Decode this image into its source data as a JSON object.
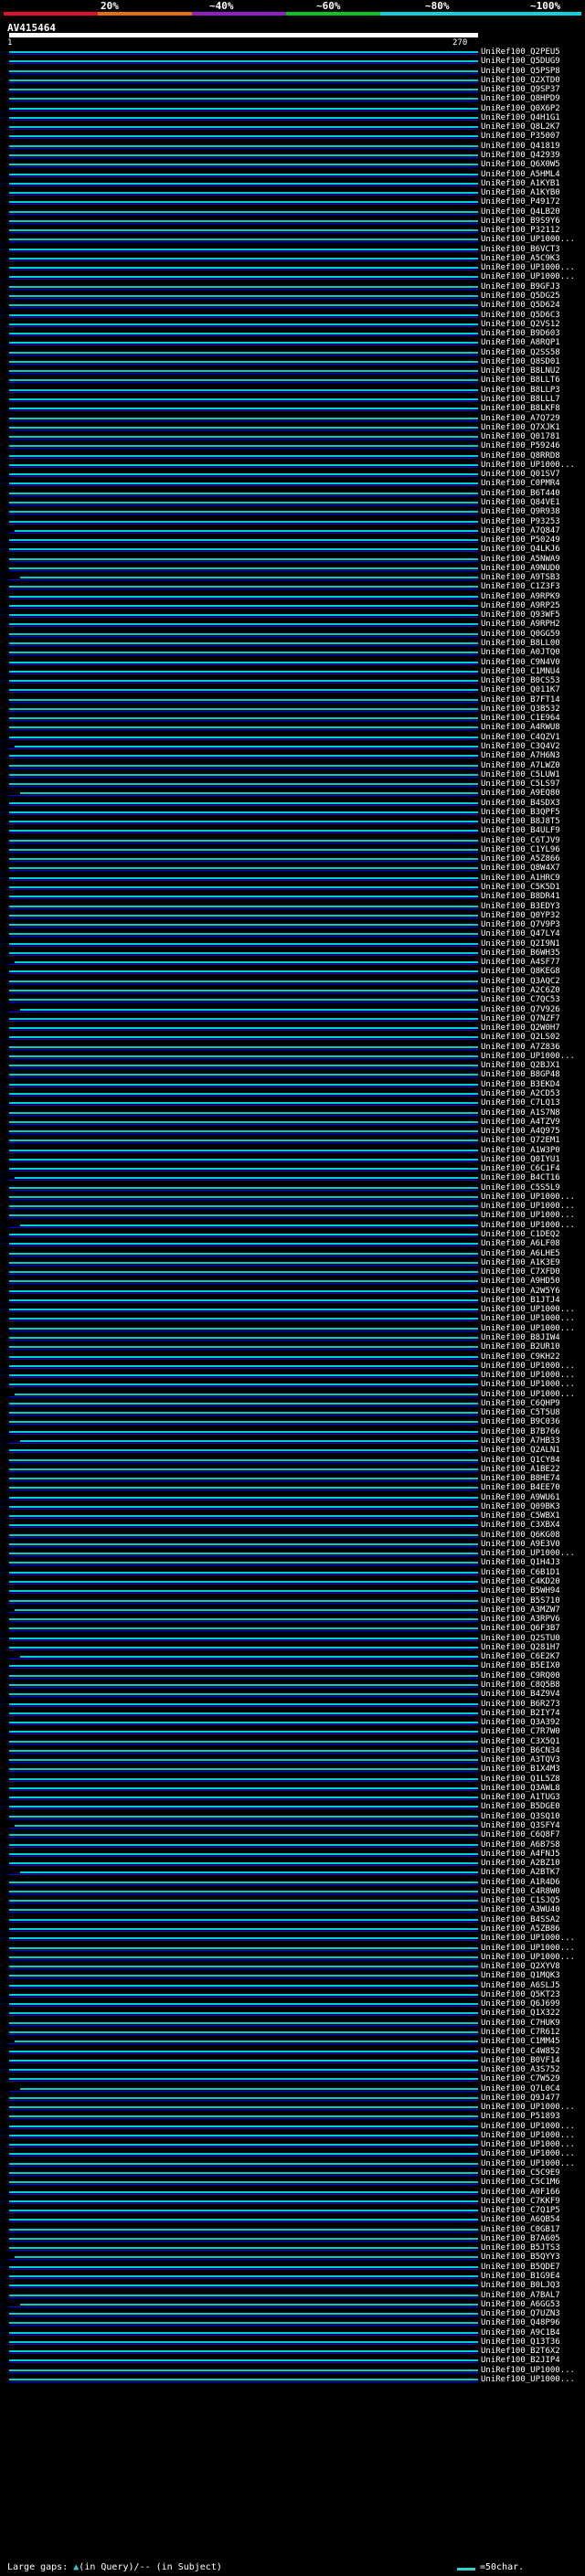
{
  "scale": {
    "ticks": [
      "20%",
      "~40%",
      "~60%",
      "~80%",
      "~100%"
    ],
    "colors": [
      "#e0102a",
      "#e07010",
      "#9020c0",
      "#10c020",
      "#10d0e0"
    ]
  },
  "query": {
    "id": "AV415464",
    "start": "1",
    "end": "270"
  },
  "line_color": "#00cccc",
  "hits": [
    {
      "id": "UniRef100_Q2PEU5"
    },
    {
      "id": "UniRef100_Q5DUG9"
    },
    {
      "id": "UniRef100_Q5PSP8"
    },
    {
      "id": "UniRef100_Q2XTD0"
    },
    {
      "id": "UniRef100_Q9SP37"
    },
    {
      "id": "UniRef100_Q8HPD9"
    },
    {
      "id": "UniRef100_Q0X6P2"
    },
    {
      "id": "UniRef100_Q4H1G1"
    },
    {
      "id": "UniRef100_Q8L2K7"
    },
    {
      "id": "UniRef100_P35007"
    },
    {
      "id": "UniRef100_Q41819"
    },
    {
      "id": "UniRef100_Q42939"
    },
    {
      "id": "UniRef100_Q6X0W5"
    },
    {
      "id": "UniRef100_A5HML4"
    },
    {
      "id": "UniRef100_A1KYB1"
    },
    {
      "id": "UniRef100_A1KYB0"
    },
    {
      "id": "UniRef100_P49172"
    },
    {
      "id": "UniRef100_Q4LB20"
    },
    {
      "id": "UniRef100_B9S9Y6"
    },
    {
      "id": "UniRef100_P32112"
    },
    {
      "id": "UniRef100_UP1000..."
    },
    {
      "id": "UniRef100_B6VCT3"
    },
    {
      "id": "UniRef100_A5C9K3"
    },
    {
      "id": "UniRef100_UP1000..."
    },
    {
      "id": "UniRef100_UP1000..."
    },
    {
      "id": "UniRef100_B9GFJ3"
    },
    {
      "id": "UniRef100_Q5DG25"
    },
    {
      "id": "UniRef100_Q5D624"
    },
    {
      "id": "UniRef100_Q5D6C3"
    },
    {
      "id": "UniRef100_Q2VS12"
    },
    {
      "id": "UniRef100_B9D603"
    },
    {
      "id": "UniRef100_A8RQP1"
    },
    {
      "id": "UniRef100_Q2SS58"
    },
    {
      "id": "UniRef100_Q8SD01"
    },
    {
      "id": "UniRef100_B8LNU2"
    },
    {
      "id": "UniRef100_B8LLT6"
    },
    {
      "id": "UniRef100_B8LLP3"
    },
    {
      "id": "UniRef100_B8LLL7"
    },
    {
      "id": "UniRef100_B8LKF8"
    },
    {
      "id": "UniRef100_A7Q729"
    },
    {
      "id": "UniRef100_Q7XJK1"
    },
    {
      "id": "UniRef100_Q01781"
    },
    {
      "id": "UniRef100_P59246"
    },
    {
      "id": "UniRef100_Q8RRD8"
    },
    {
      "id": "UniRef100_UP1000..."
    },
    {
      "id": "UniRef100_Q01SV7"
    },
    {
      "id": "UniRef100_C0PMR4"
    },
    {
      "id": "UniRef100_B6T440"
    },
    {
      "id": "UniRef100_Q84VE1"
    },
    {
      "id": "UniRef100_Q9R938"
    },
    {
      "id": "UniRef100_P93253"
    },
    {
      "id": "UniRef100_A7Q847"
    },
    {
      "id": "UniRef100_P50249"
    },
    {
      "id": "UniRef100_Q4LKJ6"
    },
    {
      "id": "UniRef100_A5NWA9"
    },
    {
      "id": "UniRef100_A9NUD0"
    },
    {
      "id": "UniRef100_A9TSB3"
    },
    {
      "id": "UniRef100_C1Z3F3"
    },
    {
      "id": "UniRef100_A9RPK9"
    },
    {
      "id": "UniRef100_A9RP25"
    },
    {
      "id": "UniRef100_Q93WF5"
    },
    {
      "id": "UniRef100_A9RPH2"
    },
    {
      "id": "UniRef100_Q0GG59"
    },
    {
      "id": "UniRef100_B8LL00"
    },
    {
      "id": "UniRef100_A0JTQ0"
    },
    {
      "id": "UniRef100_C9N4V0"
    },
    {
      "id": "UniRef100_C1MNU4"
    },
    {
      "id": "UniRef100_B0CS53"
    },
    {
      "id": "UniRef100_Q011K7"
    },
    {
      "id": "UniRef100_B7FT14"
    },
    {
      "id": "UniRef100_Q3B532"
    },
    {
      "id": "UniRef100_C1E964"
    },
    {
      "id": "UniRef100_A4RWU8"
    },
    {
      "id": "UniRef100_C4QZV1"
    },
    {
      "id": "UniRef100_C3Q4V2"
    },
    {
      "id": "UniRef100_A7H6N3"
    },
    {
      "id": "UniRef100_A7LWZ0"
    },
    {
      "id": "UniRef100_C5LUW1"
    },
    {
      "id": "UniRef100_C5LS97"
    },
    {
      "id": "UniRef100_A9EQ80"
    },
    {
      "id": "UniRef100_B4SDX3"
    },
    {
      "id": "UniRef100_B3QPF5"
    },
    {
      "id": "UniRef100_B8J8T5"
    },
    {
      "id": "UniRef100_B4ULF9"
    },
    {
      "id": "UniRef100_C6TJV9"
    },
    {
      "id": "UniRef100_C1YL96"
    },
    {
      "id": "UniRef100_A5Z866"
    },
    {
      "id": "UniRef100_Q8W4X7"
    },
    {
      "id": "UniRef100_A1HRC9"
    },
    {
      "id": "UniRef100_C5K5D1"
    },
    {
      "id": "UniRef100_B8DR41"
    },
    {
      "id": "UniRef100_B3EDY3"
    },
    {
      "id": "UniRef100_Q0YP32"
    },
    {
      "id": "UniRef100_Q7V9P3"
    },
    {
      "id": "UniRef100_Q47LY4"
    },
    {
      "id": "UniRef100_Q2I9N1"
    },
    {
      "id": "UniRef100_B6WH35"
    },
    {
      "id": "UniRef100_A4SF77"
    },
    {
      "id": "UniRef100_Q8KEG8"
    },
    {
      "id": "UniRef100_Q3AQC2"
    },
    {
      "id": "UniRef100_A2C6Z0"
    },
    {
      "id": "UniRef100_C7QC53"
    },
    {
      "id": "UniRef100_Q7V926"
    },
    {
      "id": "UniRef100_Q7NZF7"
    },
    {
      "id": "UniRef100_Q2W0H7"
    },
    {
      "id": "UniRef100_Q2LS02"
    },
    {
      "id": "UniRef100_A7Z836"
    },
    {
      "id": "UniRef100_UP1000..."
    },
    {
      "id": "UniRef100_Q2BJX1"
    },
    {
      "id": "UniRef100_B8GP48"
    },
    {
      "id": "UniRef100_B3EKD4"
    },
    {
      "id": "UniRef100_A2CD53"
    },
    {
      "id": "UniRef100_C7LQ13"
    },
    {
      "id": "UniRef100_A1S7N8"
    },
    {
      "id": "UniRef100_A4TZV9"
    },
    {
      "id": "UniRef100_A4Q975"
    },
    {
      "id": "UniRef100_Q72EM1"
    },
    {
      "id": "UniRef100_A1W3P0"
    },
    {
      "id": "UniRef100_Q0IYU1"
    },
    {
      "id": "UniRef100_C6C1F4"
    },
    {
      "id": "UniRef100_B4CT16"
    },
    {
      "id": "UniRef100_C5S5L9"
    },
    {
      "id": "UniRef100_UP1000..."
    },
    {
      "id": "UniRef100_UP1000..."
    },
    {
      "id": "UniRef100_UP1000..."
    },
    {
      "id": "UniRef100_UP1000..."
    },
    {
      "id": "UniRef100_C1DEQ2"
    },
    {
      "id": "UniRef100_A6LF08"
    },
    {
      "id": "UniRef100_A6LHE5"
    },
    {
      "id": "UniRef100_A1K3E9"
    },
    {
      "id": "UniRef100_C7XFD0"
    },
    {
      "id": "UniRef100_A9HD50"
    },
    {
      "id": "UniRef100_A2W5Y6"
    },
    {
      "id": "UniRef100_B1JTJ4"
    },
    {
      "id": "UniRef100_UP1000..."
    },
    {
      "id": "UniRef100_UP1000..."
    },
    {
      "id": "UniRef100_UP1000..."
    },
    {
      "id": "UniRef100_B8JIW4"
    },
    {
      "id": "UniRef100_B2UR10"
    },
    {
      "id": "UniRef100_C9KH22"
    },
    {
      "id": "UniRef100_UP1000..."
    },
    {
      "id": "UniRef100_UP1000..."
    },
    {
      "id": "UniRef100_UP1000..."
    },
    {
      "id": "UniRef100_UP1000..."
    },
    {
      "id": "UniRef100_C6QHP9"
    },
    {
      "id": "UniRef100_C5T5U8"
    },
    {
      "id": "UniRef100_B9C036"
    },
    {
      "id": "UniRef100_B7B766"
    },
    {
      "id": "UniRef100_A7HB33"
    },
    {
      "id": "UniRef100_Q2ALN1"
    },
    {
      "id": "UniRef100_Q1CY84"
    },
    {
      "id": "UniRef100_A1BE22"
    },
    {
      "id": "UniRef100_B8HE74"
    },
    {
      "id": "UniRef100_B4EE70"
    },
    {
      "id": "UniRef100_A9WU61"
    },
    {
      "id": "UniRef100_Q09BK3"
    },
    {
      "id": "UniRef100_C5WBX1"
    },
    {
      "id": "UniRef100_C3XBX4"
    },
    {
      "id": "UniRef100_Q6KG08"
    },
    {
      "id": "UniRef100_A9E3V0"
    },
    {
      "id": "UniRef100_UP1000..."
    },
    {
      "id": "UniRef100_Q1H4J3"
    },
    {
      "id": "UniRef100_C6B1D1"
    },
    {
      "id": "UniRef100_C4KD20"
    },
    {
      "id": "UniRef100_B5WH94"
    },
    {
      "id": "UniRef100_B5S710"
    },
    {
      "id": "UniRef100_A3MZW7"
    },
    {
      "id": "UniRef100_A3RPV6"
    },
    {
      "id": "UniRef100_Q6F3B7"
    },
    {
      "id": "UniRef100_Q2STU0"
    },
    {
      "id": "UniRef100_Q281H7"
    },
    {
      "id": "UniRef100_C6E2K7"
    },
    {
      "id": "UniRef100_B5EIX0"
    },
    {
      "id": "UniRef100_C9RQ00"
    },
    {
      "id": "UniRef100_C8Q5B8"
    },
    {
      "id": "UniRef100_B4Z9V4"
    },
    {
      "id": "UniRef100_B6R273"
    },
    {
      "id": "UniRef100_B2IY74"
    },
    {
      "id": "UniRef100_Q3A392"
    },
    {
      "id": "UniRef100_C7R7W0"
    },
    {
      "id": "UniRef100_C3X5Q1"
    },
    {
      "id": "UniRef100_B6CN34"
    },
    {
      "id": "UniRef100_A3TQV3"
    },
    {
      "id": "UniRef100_B1X4M3"
    },
    {
      "id": "UniRef100_Q1L5Z8"
    },
    {
      "id": "UniRef100_Q3AWL8"
    },
    {
      "id": "UniRef100_A1TUG3"
    },
    {
      "id": "UniRef100_B5DGE0"
    },
    {
      "id": "UniRef100_Q3SQ10"
    },
    {
      "id": "UniRef100_Q3SFY4"
    },
    {
      "id": "UniRef100_C6Q8F7"
    },
    {
      "id": "UniRef100_A6B7S8"
    },
    {
      "id": "UniRef100_A4FNJ5"
    },
    {
      "id": "UniRef100_A2BZ10"
    },
    {
      "id": "UniRef100_A2BTK7"
    },
    {
      "id": "UniRef100_A1R4D6"
    },
    {
      "id": "UniRef100_C4R8W0"
    },
    {
      "id": "UniRef100_C1SJQ5"
    },
    {
      "id": "UniRef100_A3WU40"
    },
    {
      "id": "UniRef100_B4SSA2"
    },
    {
      "id": "UniRef100_A5ZB86"
    },
    {
      "id": "UniRef100_UP1000..."
    },
    {
      "id": "UniRef100_UP1000..."
    },
    {
      "id": "UniRef100_UP1000..."
    },
    {
      "id": "UniRef100_Q2XYV8"
    },
    {
      "id": "UniRef100_Q1MQK3"
    },
    {
      "id": "UniRef100_A6SLJ5"
    },
    {
      "id": "UniRef100_Q5KT23"
    },
    {
      "id": "UniRef100_Q6J699"
    },
    {
      "id": "UniRef100_Q1X322"
    },
    {
      "id": "UniRef100_C7HUK9"
    },
    {
      "id": "UniRef100_C7R612"
    },
    {
      "id": "UniRef100_C1MM45"
    },
    {
      "id": "UniRef100_C4W852"
    },
    {
      "id": "UniRef100_B0VF14"
    },
    {
      "id": "UniRef100_A3S752"
    },
    {
      "id": "UniRef100_C7W529"
    },
    {
      "id": "UniRef100_Q7L0C4"
    },
    {
      "id": "UniRef100_Q9J477"
    },
    {
      "id": "UniRef100_UP1000..."
    },
    {
      "id": "UniRef100_P51893"
    },
    {
      "id": "UniRef100_UP1000..."
    },
    {
      "id": "UniRef100_UP1000..."
    },
    {
      "id": "UniRef100_UP1000..."
    },
    {
      "id": "UniRef100_UP1000..."
    },
    {
      "id": "UniRef100_UP1000..."
    },
    {
      "id": "UniRef100_C5C9E9"
    },
    {
      "id": "UniRef100_C5C1M6"
    },
    {
      "id": "UniRef100_A0F166"
    },
    {
      "id": "UniRef100_C7KKF9"
    },
    {
      "id": "UniRef100_C7Q1P5"
    },
    {
      "id": "UniRef100_A6QB54"
    },
    {
      "id": "UniRef100_C0GB17"
    },
    {
      "id": "UniRef100_B7A605"
    },
    {
      "id": "UniRef100_B5JTS3"
    },
    {
      "id": "UniRef100_B5QYY3"
    },
    {
      "id": "UniRef100_B5QDE7"
    },
    {
      "id": "UniRef100_B1G9E4"
    },
    {
      "id": "UniRef100_B0LJQ3"
    },
    {
      "id": "UniRef100_A7BAL7"
    },
    {
      "id": "UniRef100_A6GG53"
    },
    {
      "id": "UniRef100_Q7UZN3"
    },
    {
      "id": "UniRef100_Q48P96"
    },
    {
      "id": "UniRef100_A9C1B4"
    },
    {
      "id": "UniRef100_Q13T36"
    },
    {
      "id": "UniRef100_B2T6X2"
    },
    {
      "id": "UniRef100_B2JIP4"
    },
    {
      "id": "UniRef100_UP1000..."
    },
    {
      "id": "UniRef100_UP1000..."
    }
  ],
  "legend": {
    "gaps_label": "Large gaps:",
    "in_query_symbol": "▲",
    "in_query_text": "(in Query)",
    "in_subject_symbol": "/",
    "in_subject_text": "-- (in Subject)",
    "scale_text": "=50char."
  }
}
